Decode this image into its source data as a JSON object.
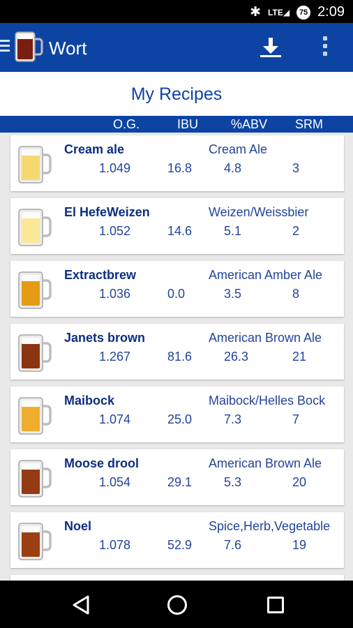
{
  "status": {
    "time": "2:09",
    "network": "LTE",
    "battery": "75"
  },
  "app": {
    "title": "Wort"
  },
  "page": {
    "title": "My Recipes"
  },
  "columns": {
    "og": "O.G.",
    "ibu": "IBU",
    "abv": "%ABV",
    "srm": "SRM"
  },
  "recipes": [
    {
      "name": "Cream ale",
      "style": "Cream Ale",
      "og": "1.049",
      "ibu": "16.8",
      "abv": "4.8",
      "srm": "3",
      "color": "#f5d870"
    },
    {
      "name": "El HefeWeizen",
      "style": "Weizen/Weissbier",
      "og": "1.052",
      "ibu": "14.6",
      "abv": "5.1",
      "srm": "2",
      "color": "#fbe899"
    },
    {
      "name": "Extractbrew",
      "style": "American Amber Ale",
      "og": "1.036",
      "ibu": "0.0",
      "abv": "3.5",
      "srm": "8",
      "color": "#e59b14"
    },
    {
      "name": "Janets brown",
      "style": "American Brown Ale",
      "og": "1.267",
      "ibu": "81.6",
      "abv": "26.3",
      "srm": "21",
      "color": "#8a3412"
    },
    {
      "name": "Maibock",
      "style": "Maibock/Helles Bock",
      "og": "1.074",
      "ibu": "25.0",
      "abv": "7.3",
      "srm": "7",
      "color": "#efae2d"
    },
    {
      "name": "Moose drool",
      "style": "American Brown Ale",
      "og": "1.054",
      "ibu": "29.1",
      "abv": "5.3",
      "srm": "20",
      "color": "#953b13"
    },
    {
      "name": "Noel",
      "style": "Spice,Herb,Vegetable",
      "og": "1.078",
      "ibu": "52.9",
      "abv": "7.6",
      "srm": "19",
      "color": "#9b3f14"
    }
  ]
}
